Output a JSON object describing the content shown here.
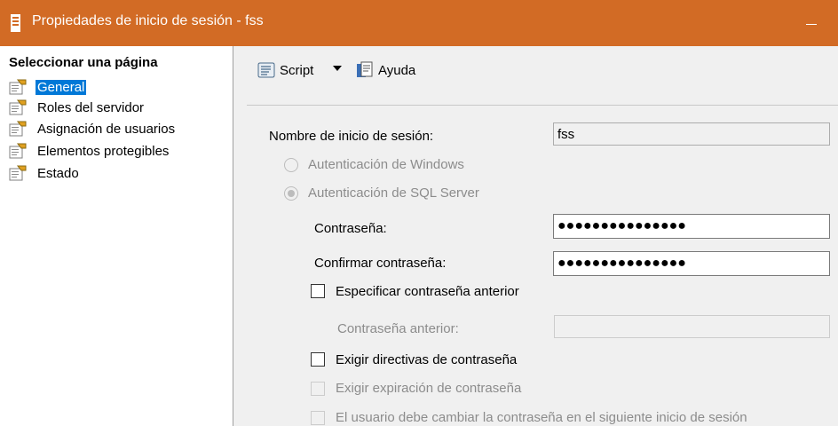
{
  "window": {
    "title": "Propiedades de inicio de sesión - fss",
    "titlebar_color": "#d26b25"
  },
  "sidebar": {
    "header": "Seleccionar una página",
    "items": [
      {
        "label": "General",
        "icon": "page-settings-icon",
        "selected": true
      },
      {
        "label": "Roles del servidor",
        "icon": "page-settings-icon",
        "selected": false
      },
      {
        "label": "Asignación de usuarios",
        "icon": "page-settings-icon",
        "selected": false
      },
      {
        "label": "Elementos protegibles",
        "icon": "page-settings-icon",
        "selected": false
      },
      {
        "label": "Estado",
        "icon": "page-settings-icon",
        "selected": false
      }
    ],
    "selection_color": "#0078d7"
  },
  "toolbar": {
    "script_label": "Script",
    "help_label": "Ayuda"
  },
  "form": {
    "login_name_label": "Nombre de inicio de sesión:",
    "login_name_value": "fss",
    "windows_auth_label": "Autenticación de Windows",
    "sql_auth_label": "Autenticación de SQL Server",
    "password_label": "Contraseña:",
    "password_value": "●●●●●●●●●●●●●●●",
    "confirm_password_label": "Confirmar contraseña:",
    "confirm_password_value": "●●●●●●●●●●●●●●●",
    "specify_old_password_label": "Especificar contraseña anterior",
    "old_password_label": "Contraseña anterior:",
    "enforce_policy_label": "Exigir directivas de contraseña",
    "enforce_expiration_label": "Exigir expiración de contraseña",
    "must_change_label": "El usuario debe cambiar la contraseña en el siguiente inicio de sesión"
  }
}
